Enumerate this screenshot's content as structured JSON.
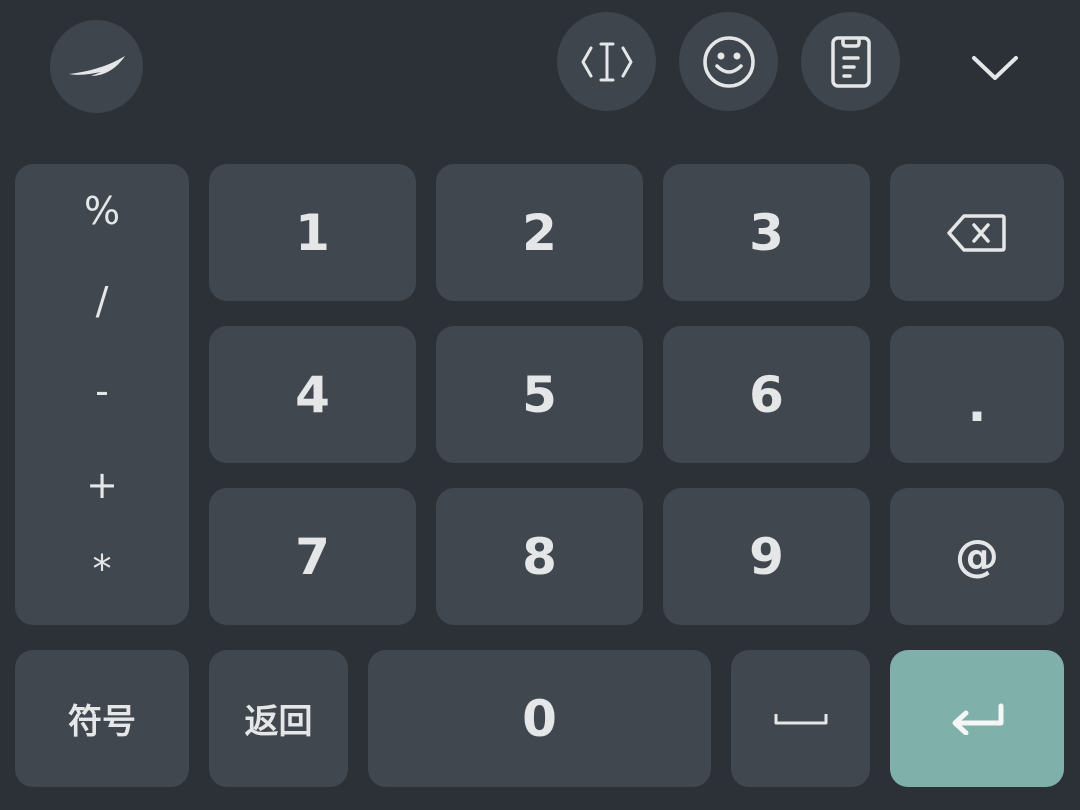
{
  "toolbar": {
    "logo_icon": "swoosh-logo-icon",
    "cursor_icon": "text-cursor-icon",
    "emoji_icon": "smiley-icon",
    "clipboard_icon": "clipboard-icon",
    "collapse_icon": "chevron-down-icon"
  },
  "symbols": [
    "%",
    "/",
    "-",
    "+",
    "*"
  ],
  "keys": {
    "k1": "1",
    "k2": "2",
    "k3": "3",
    "k4": "4",
    "k5": "5",
    "k6": "6",
    "k7": "7",
    "k8": "8",
    "k9": "9",
    "k0": "0",
    "dot": ".",
    "at": "@",
    "symbol_mode": "符号",
    "back": "返回"
  },
  "colors": {
    "background": "#2b3137",
    "key": "#41474e",
    "enter": "#7fb0aa",
    "text": "#e4e6e8"
  }
}
